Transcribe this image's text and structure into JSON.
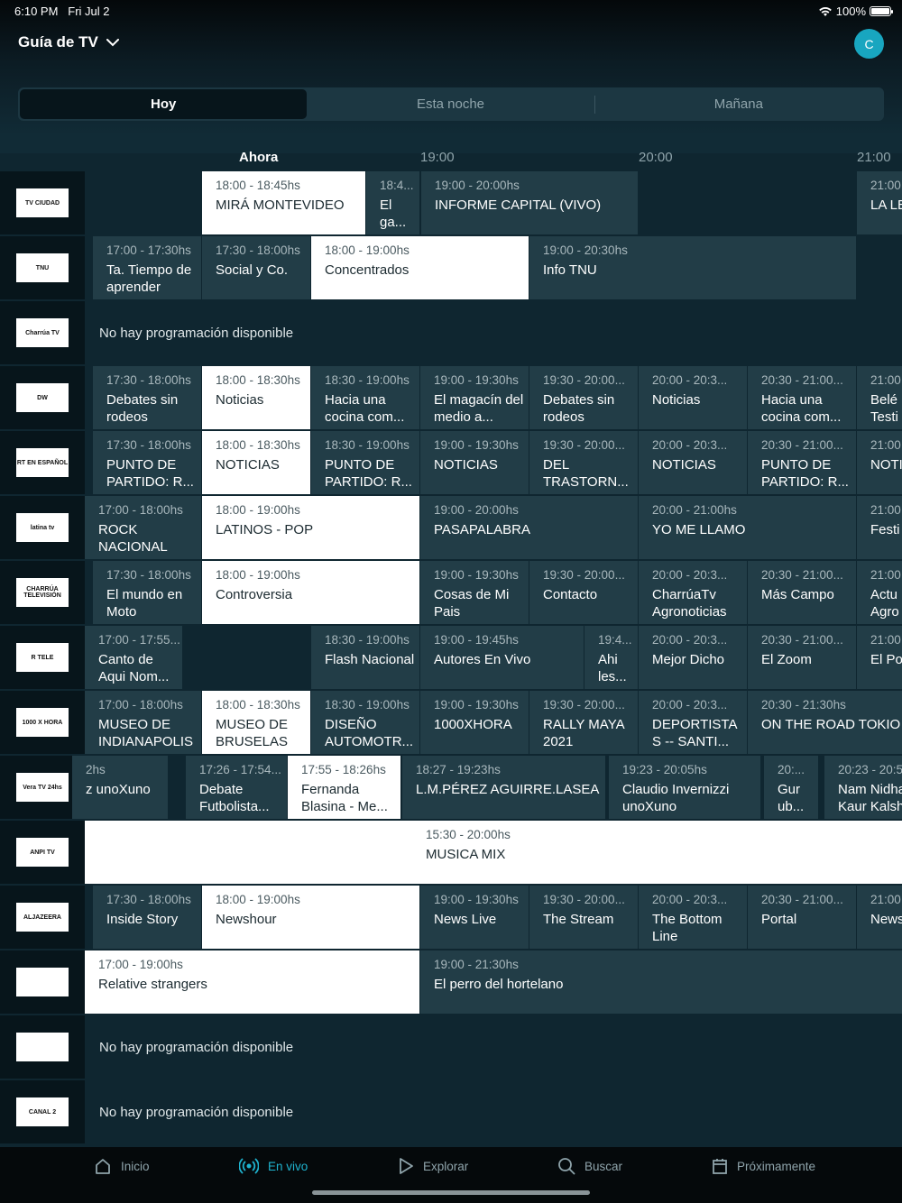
{
  "status": {
    "time": "6:10 PM",
    "date": "Fri Jul 2",
    "battery": "100%"
  },
  "header": {
    "title": "Guía de TV",
    "avatar_initial": "C"
  },
  "tabs": [
    {
      "label": "Hoy",
      "active": true
    },
    {
      "label": "Esta noche",
      "active": false
    },
    {
      "label": "Mañana",
      "active": false
    }
  ],
  "timeline": {
    "now": "Ahora",
    "t1": "19:00",
    "t2": "20:00",
    "t3": "21:00"
  },
  "no_program_text": "No hay programación disponible",
  "channels": [
    {
      "logo": "TV CIUDAD",
      "programs": [
        {
          "time": "18:00 - 18:45hs",
          "title": "MIRÁ MONTEVIDEO",
          "current": true
        },
        {
          "time": "18:4...",
          "title": "El ga..."
        },
        {
          "time": "19:00 - 20:00hs",
          "title": "INFORME CAPITAL (VIVO)"
        },
        {
          "time": "21:00",
          "title": "LA LE"
        }
      ]
    },
    {
      "logo": "TNU",
      "programs": [
        {
          "time": "17:00 - 17:30hs",
          "title": "Ta. Tiempo de aprender"
        },
        {
          "time": "17:30 - 18:00hs",
          "title": "Social y Co."
        },
        {
          "time": "18:00 - 19:00hs",
          "title": "Concentrados",
          "current": true
        },
        {
          "time": "19:00 - 20:30hs",
          "title": "Info TNU"
        }
      ]
    },
    {
      "logo": "Charrúa TV",
      "programs": []
    },
    {
      "logo": "DW",
      "programs": [
        {
          "time": "17:30 - 18:00hs",
          "title": "Debates sin rodeos"
        },
        {
          "time": "18:00 - 18:30hs",
          "title": "Noticias",
          "current": true
        },
        {
          "time": "18:30 - 19:00hs",
          "title": "Hacia una cocina com..."
        },
        {
          "time": "19:00 - 19:30hs",
          "title": "El magacín del medio a..."
        },
        {
          "time": "19:30 - 20:00...",
          "title": "Debates sin rodeos"
        },
        {
          "time": "20:00 - 20:3...",
          "title": "Noticias"
        },
        {
          "time": "20:30 - 21:00...",
          "title": "Hacia una cocina com..."
        },
        {
          "time": "21:00",
          "title": "Belé Testi"
        }
      ]
    },
    {
      "logo": "RT EN ESPAÑOL",
      "programs": [
        {
          "time": "17:30 - 18:00hs",
          "title": "PUNTO DE PARTIDO: R..."
        },
        {
          "time": "18:00 - 18:30hs",
          "title": "NOTICIAS",
          "current": true
        },
        {
          "time": "18:30 - 19:00hs",
          "title": "PUNTO DE PARTIDO: R..."
        },
        {
          "time": "19:00 - 19:30hs",
          "title": "NOTICIAS"
        },
        {
          "time": "19:30 - 20:00...",
          "title": "DEL TRASTORN..."
        },
        {
          "time": "20:00 - 20:3...",
          "title": "NOTICIAS"
        },
        {
          "time": "20:30 - 21:00...",
          "title": "PUNTO DE PARTIDO: R..."
        },
        {
          "time": "21:00",
          "title": "NOTI"
        }
      ]
    },
    {
      "logo": "latina tv",
      "programs": [
        {
          "time": "17:00 - 18:00hs",
          "title": "ROCK NACIONAL"
        },
        {
          "time": "18:00 - 19:00hs",
          "title": "LATINOS - POP",
          "current": true
        },
        {
          "time": "19:00 - 20:00hs",
          "title": "PASAPALABRA"
        },
        {
          "time": "20:00 - 21:00hs",
          "title": "YO ME LLAMO"
        },
        {
          "time": "21:00",
          "title": "Festi"
        }
      ]
    },
    {
      "logo": "CHARRÚA TELEVISIÓN",
      "programs": [
        {
          "time": "17:30 - 18:00hs",
          "title": "El mundo en Moto"
        },
        {
          "time": "18:00 - 19:00hs",
          "title": "Controversia",
          "current": true
        },
        {
          "time": "19:00 - 19:30hs",
          "title": "Cosas de Mi Pais"
        },
        {
          "time": "19:30 - 20:00...",
          "title": "Contacto"
        },
        {
          "time": "20:00 - 20:3...",
          "title": "CharrúaTv Agronoticias"
        },
        {
          "time": "20:30 - 21:00...",
          "title": "Más Campo"
        },
        {
          "time": "21:00",
          "title": "Actu Agro"
        }
      ]
    },
    {
      "logo": "R TELE",
      "programs": [
        {
          "time": "17:00 - 17:55...",
          "title": "Canto de Aqui Nom..."
        },
        {
          "time": "",
          "title": ""
        },
        {
          "time": "18:30 - 19:00hs",
          "title": "Flash Nacional"
        },
        {
          "time": "19:00 - 19:45hs",
          "title": "Autores En Vivo"
        },
        {
          "time": "19:4...",
          "title": "Ahi les..."
        },
        {
          "time": "20:00 - 20:3...",
          "title": "Mejor Dicho"
        },
        {
          "time": "20:30 - 21:00...",
          "title": "El Zoom"
        },
        {
          "time": "21:00",
          "title": "El Po"
        }
      ]
    },
    {
      "logo": "1000 X HORA",
      "programs": [
        {
          "time": "17:00 - 18:00hs",
          "title": "MUSEO DE INDIANAPOLIS"
        },
        {
          "time": "18:00 - 18:30hs",
          "title": "MUSEO DE BRUSELAS",
          "current": true
        },
        {
          "time": "18:30 - 19:00hs",
          "title": "DISEÑO AUTOMOTR..."
        },
        {
          "time": "19:00 - 19:30hs",
          "title": "1000XHORA"
        },
        {
          "time": "19:30 - 20:00...",
          "title": "RALLY MAYA 2021"
        },
        {
          "time": "20:00 - 20:3...",
          "title": "DEPORTISTA S -- SANTI..."
        },
        {
          "time": "20:30 - 21:30hs",
          "title": "ON THE ROAD TOKIO"
        }
      ]
    },
    {
      "logo": "Vera TV 24hs",
      "programs": [
        {
          "time": "2hs",
          "title": "z unoXuno"
        },
        {
          "time": "17:26 - 17:54...",
          "title": "Debate Futbolista..."
        },
        {
          "time": "17:55 - 18:26hs",
          "title": "Fernanda Blasina - Me...",
          "current": true
        },
        {
          "time": "18:27 - 19:23hs",
          "title": "L.M.PÉREZ AGUIRRE.LASEA"
        },
        {
          "time": "19:23 - 20:05hs",
          "title": "Claudio Invernizzi unoXuno"
        },
        {
          "time": "20:...",
          "title": "Gur ub..."
        },
        {
          "time": "20:23 - 20:5",
          "title": "Nam Nidha Kaur Kalsh"
        }
      ]
    },
    {
      "logo": "ANPI TV",
      "programs": [
        {
          "time": "15:30 - 20:00hs",
          "title": "MUSICA MIX",
          "current": true
        }
      ]
    },
    {
      "logo": "ALJAZEERA",
      "programs": [
        {
          "time": "17:30 - 18:00hs",
          "title": "Inside Story"
        },
        {
          "time": "18:00 - 19:00hs",
          "title": "Newshour",
          "current": true
        },
        {
          "time": "19:00 - 19:30hs",
          "title": "News Live"
        },
        {
          "time": "19:30 - 20:00...",
          "title": "The Stream"
        },
        {
          "time": "20:00 - 20:3...",
          "title": "The Bottom Line"
        },
        {
          "time": "20:30 - 21:00...",
          "title": "Portal"
        },
        {
          "time": "21:00",
          "title": "News"
        }
      ]
    },
    {
      "logo": "",
      "programs": [
        {
          "time": "17:00 - 19:00hs",
          "title": "Relative strangers",
          "current": true
        },
        {
          "time": "19:00 - 21:30hs",
          "title": "El perro del hortelano"
        }
      ]
    },
    {
      "logo": "",
      "programs": []
    },
    {
      "logo": "CANAL 2",
      "programs": []
    }
  ],
  "bottom_nav": [
    {
      "label": "Inicio",
      "icon": "home-icon"
    },
    {
      "label": "En vivo",
      "icon": "live-icon",
      "active": true
    },
    {
      "label": "Explorar",
      "icon": "play-icon"
    },
    {
      "label": "Buscar",
      "icon": "search-icon"
    },
    {
      "label": "Próximamente",
      "icon": "calendar-icon"
    }
  ],
  "colors": {
    "accent": "#1fb3cf",
    "cell": "#223d47",
    "current_cell": "#ffffff",
    "background": "#0f2630"
  }
}
